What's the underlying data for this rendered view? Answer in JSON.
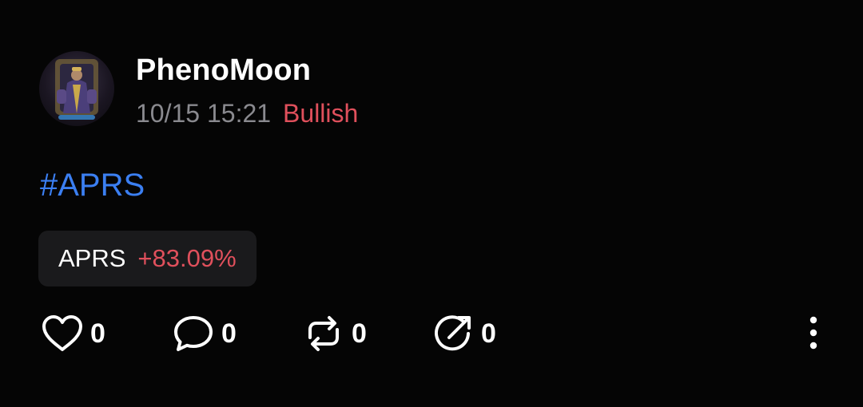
{
  "post": {
    "username": "PhenoMoon",
    "timestamp": "10/15 15:21",
    "sentiment": "Bullish",
    "hashtag": "#APRS",
    "ticker": {
      "symbol": "APRS",
      "change": "+83.09%"
    }
  },
  "actions": {
    "like": {
      "icon": "heart-icon",
      "count": "0"
    },
    "comment": {
      "icon": "comment-bubble-icon",
      "count": "0"
    },
    "repost": {
      "icon": "repost-icon",
      "count": "0"
    },
    "share": {
      "icon": "share-arrow-icon",
      "count": "0"
    },
    "more": {
      "icon": "more-vertical-icon"
    }
  },
  "colors": {
    "background": "#050505",
    "bullish": "#e0505c",
    "positive_change": "#e0505c",
    "hashtag": "#3b7ff2",
    "muted_text": "#8a8a8f",
    "chip_background": "#1a1a1c"
  }
}
